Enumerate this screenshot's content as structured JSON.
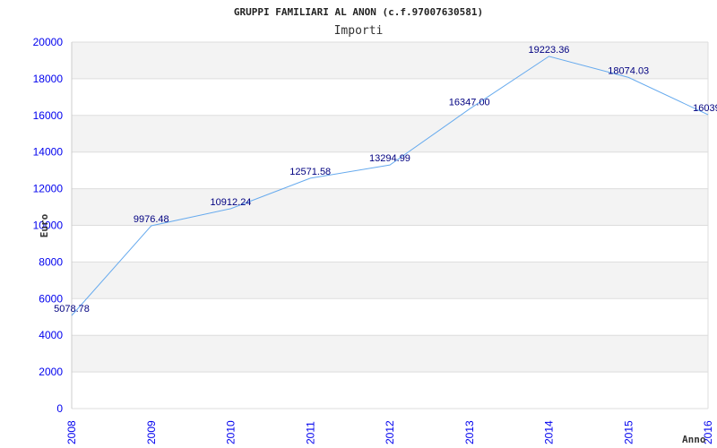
{
  "chart_data": {
    "type": "line",
    "title": "GRUPPI FAMILIARI AL ANON (c.f.97007630581)",
    "subtitle": "Importi",
    "xlabel": "Anno",
    "ylabel": "Euro",
    "x": [
      "2008",
      "2009",
      "2010",
      "2011",
      "2012",
      "2013",
      "2014",
      "2015",
      "2016"
    ],
    "values": [
      5078.78,
      9976.48,
      10912.24,
      12571.58,
      13294.99,
      16347.0,
      19223.36,
      18074.03,
      16039
    ],
    "data_labels": [
      "5078.78",
      "9976.48",
      "10912.24",
      "12571.58",
      "13294.99",
      "16347.00",
      "19223.36",
      "18074.03",
      "16039."
    ],
    "ylim": [
      0,
      20000
    ],
    "yticks": [
      "0",
      "2000",
      "4000",
      "6000",
      "8000",
      "10000",
      "12000",
      "14000",
      "16000",
      "18000",
      "20000"
    ],
    "grid": true,
    "colors": {
      "line": "#66aaee",
      "band": "#f3f3f3",
      "tick": "#0000ee",
      "data_label": "#000080"
    }
  }
}
